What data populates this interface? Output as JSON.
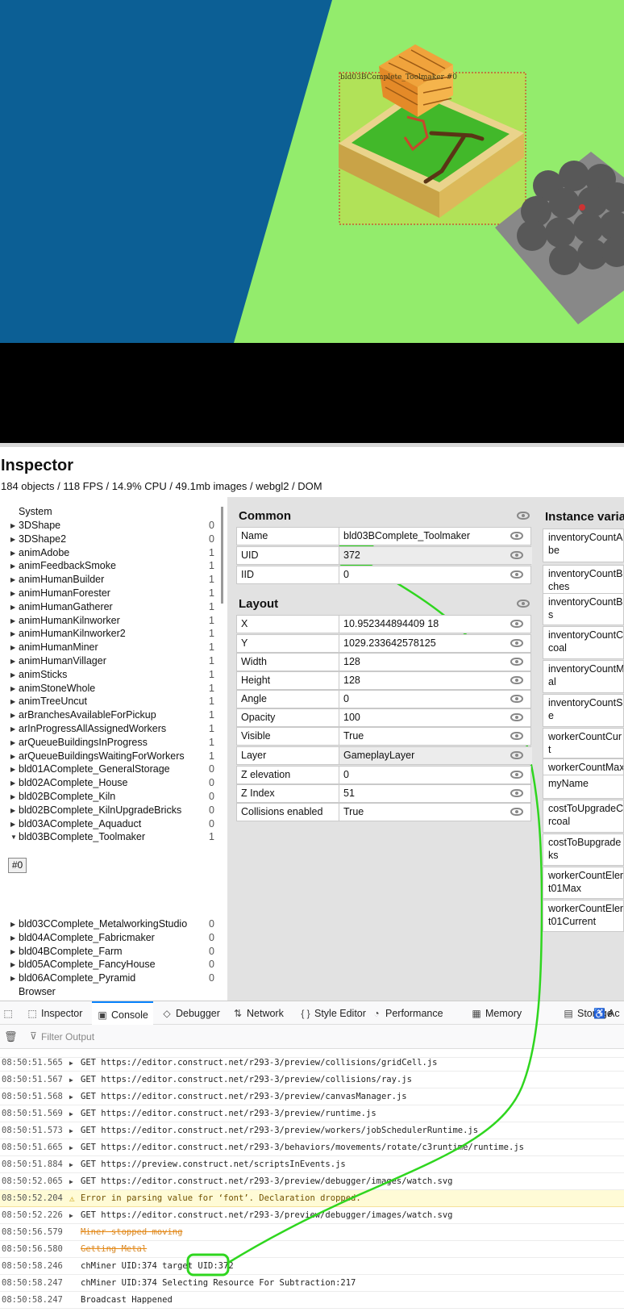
{
  "game": {
    "selected_label": "bld03BComplete_Toolmaker #0"
  },
  "inspector": {
    "title": "Inspector",
    "stats": "184 objects / 118 FPS / 14.9% CPU / 49.1mb images / webgl2 / DOM"
  },
  "tree": {
    "system_label": "System",
    "items": [
      {
        "label": "3DShape",
        "count": "0"
      },
      {
        "label": "3DShape2",
        "count": "0"
      },
      {
        "label": "animAdobe",
        "count": "1"
      },
      {
        "label": "animFeedbackSmoke",
        "count": "1"
      },
      {
        "label": "animHumanBuilder",
        "count": "1"
      },
      {
        "label": "animHumanForester",
        "count": "1"
      },
      {
        "label": "animHumanGatherer",
        "count": "1"
      },
      {
        "label": "animHumanKilnworker",
        "count": "1"
      },
      {
        "label": "animHumanKilnworker2",
        "count": "1"
      },
      {
        "label": "animHumanMiner",
        "count": "1"
      },
      {
        "label": "animHumanVillager",
        "count": "1"
      },
      {
        "label": "animSticks",
        "count": "1"
      },
      {
        "label": "animStoneWhole",
        "count": "1"
      },
      {
        "label": "animTreeUncut",
        "count": "1"
      },
      {
        "label": "arBranchesAvailableForPickup",
        "count": "1"
      },
      {
        "label": "arInProgressAllAssignedWorkers",
        "count": "1"
      },
      {
        "label": "arQueueBuildingsInProgress",
        "count": "1"
      },
      {
        "label": "arQueueBuildingsWaitingForWorkers",
        "count": "1"
      },
      {
        "label": "bld01AComplete_GeneralStorage",
        "count": "0"
      },
      {
        "label": "bld02AComplete_House",
        "count": "0"
      },
      {
        "label": "bld02BComplete_Kiln",
        "count": "0"
      },
      {
        "label": "bld02BComplete_KilnUpgradeBricks",
        "count": "0"
      },
      {
        "label": "bld03AComplete_Aquaduct",
        "count": "0"
      },
      {
        "label": "bld03BComplete_Toolmaker",
        "count": "1"
      }
    ],
    "instance_chip": "#0",
    "items_after": [
      {
        "label": "bld03CComplete_MetalworkingStudio",
        "count": "0"
      },
      {
        "label": "bld04AComplete_Fabricmaker",
        "count": "0"
      },
      {
        "label": "bld04BComplete_Farm",
        "count": "0"
      },
      {
        "label": "bld05AComplete_FancyHouse",
        "count": "0"
      },
      {
        "label": "bld06AComplete_Pyramid",
        "count": "0"
      }
    ],
    "browser_label": "Browser"
  },
  "common": {
    "title": "Common",
    "props": [
      {
        "name": "Name",
        "value": "bld03BComplete_Toolmaker"
      },
      {
        "name": "UID",
        "value": "372"
      },
      {
        "name": "IID",
        "value": "0"
      }
    ]
  },
  "layout": {
    "title": "Layout",
    "props": [
      {
        "name": "X",
        "value": "10.952344894409 18"
      },
      {
        "name": "Y",
        "value": "1029.233642578125"
      },
      {
        "name": "Width",
        "value": "128"
      },
      {
        "name": "Height",
        "value": "128"
      },
      {
        "name": "Angle",
        "value": "0"
      },
      {
        "name": "Opacity",
        "value": "100"
      },
      {
        "name": "Visible",
        "value": "True"
      },
      {
        "name": "Layer",
        "value": "GameplayLayer"
      },
      {
        "name": "Z elevation",
        "value": "0"
      },
      {
        "name": "Z Index",
        "value": "51"
      },
      {
        "name": "Collisions enabled",
        "value": "True"
      }
    ]
  },
  "instance_vars": {
    "title": "Instance varia",
    "rows": [
      "inventoryCountA\nbe",
      "inventoryCountB\nches",
      "inventoryCountB\ns",
      "inventoryCountC\ncoal",
      "inventoryCountM\nal",
      "inventoryCountS\ne",
      "workerCountCur\nt",
      "workerCountMax",
      "myName",
      "costToUpgradeC\nrcoal",
      "costToBupgrade\nks",
      "workerCountElen\nt01Max",
      "workerCountElen\nt01Current"
    ]
  },
  "devtools": {
    "tabs": [
      {
        "label": "Inspector",
        "icon": "inspector-icon"
      },
      {
        "label": "Console",
        "icon": "console-icon"
      },
      {
        "label": "Debugger",
        "icon": "debugger-icon"
      },
      {
        "label": "Network",
        "icon": "network-icon"
      },
      {
        "label": "Style Editor",
        "icon": "style-editor-icon"
      },
      {
        "label": "Performance",
        "icon": "performance-icon"
      },
      {
        "label": "Memory",
        "icon": "memory-icon"
      },
      {
        "label": "Storage",
        "icon": "storage-icon"
      },
      {
        "label": "Ac",
        "icon": "accessibility-icon"
      }
    ],
    "filter_placeholder": "Filter Output"
  },
  "console": {
    "rows": [
      {
        "time": "08:50:51.565",
        "type": "get",
        "text": "GET https://editor.construct.net/r293-3/preview/collisions/gridCell.js"
      },
      {
        "time": "08:50:51.567",
        "type": "get",
        "text": "GET https://editor.construct.net/r293-3/preview/collisions/ray.js"
      },
      {
        "time": "08:50:51.568",
        "type": "get",
        "text": "GET https://editor.construct.net/r293-3/preview/canvasManager.js"
      },
      {
        "time": "08:50:51.569",
        "type": "get",
        "text": "GET https://editor.construct.net/r293-3/preview/runtime.js"
      },
      {
        "time": "08:50:51.573",
        "type": "get",
        "text": "GET https://editor.construct.net/r293-3/preview/workers/jobSchedulerRuntime.js"
      },
      {
        "time": "08:50:51.665",
        "type": "get",
        "text": "GET https://editor.construct.net/r293-3/behaviors/movements/rotate/c3runtime/runtime.js"
      },
      {
        "time": "08:50:51.884",
        "type": "get",
        "text": "GET https://preview.construct.net/scriptsInEvents.js"
      },
      {
        "time": "08:50:52.065",
        "type": "get",
        "text": "GET https://editor.construct.net/r293-3/preview/debugger/images/watch.svg"
      },
      {
        "time": "08:50:52.204",
        "type": "warn",
        "text": "Error in parsing value for ‘font’.  Declaration dropped."
      },
      {
        "time": "08:50:52.226",
        "type": "get",
        "text": "GET https://editor.construct.net/r293-3/preview/debugger/images/watch.svg"
      },
      {
        "time": "08:50:56.579",
        "type": "struck",
        "text": "Miner stopped moving"
      },
      {
        "time": "08:50:56.580",
        "type": "struck",
        "text": "Getting Metal"
      },
      {
        "time": "08:50:58.246",
        "type": "log",
        "text": "chMiner UID:374 target UID:372"
      },
      {
        "time": "08:50:58.247",
        "type": "log",
        "text": "chMiner UID:374 Selecting Resource For Subtraction:217"
      },
      {
        "time": "08:50:58.247",
        "type": "log",
        "text": "Broadcast Happened"
      }
    ]
  },
  "colors": {
    "grass": "#93ec6c",
    "river": "#0c5f95",
    "annotation": "#2fd61f",
    "strike": "#e8860b",
    "selection": "#d23b2a"
  }
}
